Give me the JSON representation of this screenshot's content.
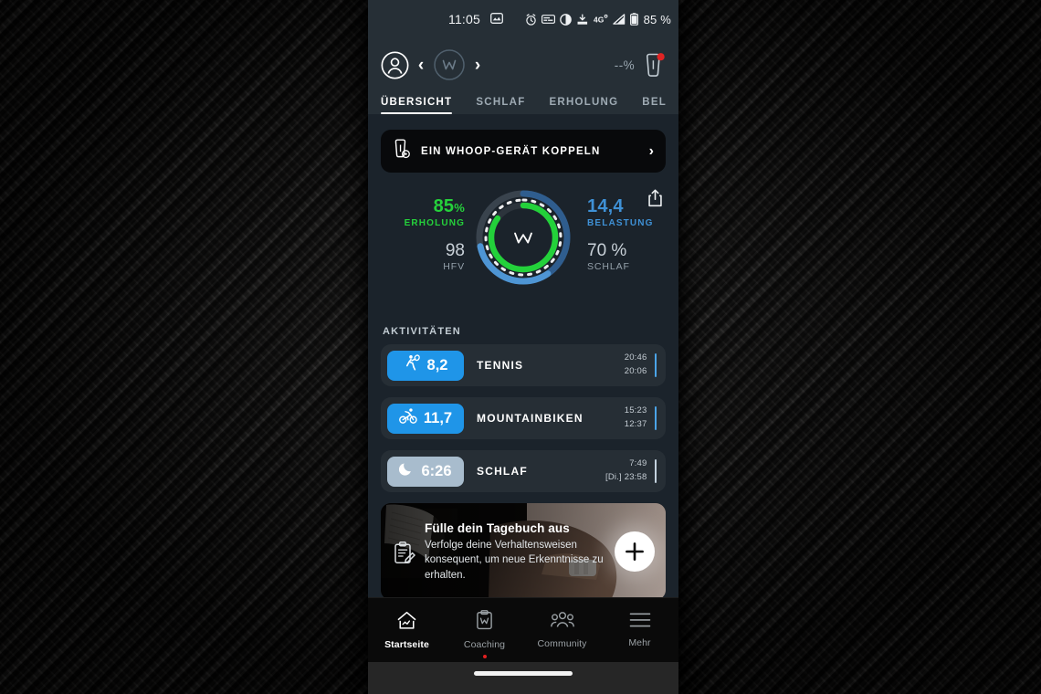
{
  "status_bar": {
    "time": "11:05",
    "battery_percent": "85 %",
    "icons": [
      "screenshot-icon",
      "alarm-icon",
      "subtitles-icon",
      "dnd-icon",
      "download-icon",
      "network-4g-icon",
      "signal-icon",
      "battery-icon"
    ]
  },
  "header": {
    "avatar": "profile-avatar-icon",
    "prev_label": "‹",
    "next_label": "›",
    "center_logo": "whoop-logo-icon",
    "battery_text": "--%",
    "strap_icon": "whoop-strap-icon",
    "tabs": [
      {
        "label": "ÜBERSICHT",
        "active": true
      },
      {
        "label": "SCHLAF",
        "active": false
      },
      {
        "label": "ERHOLUNG",
        "active": false
      },
      {
        "label": "BELASTUI",
        "active": false
      }
    ]
  },
  "pair_banner": {
    "label": "EIN WHOOP-GERÄT KOPPELN",
    "icon": "whoop-strap-icon",
    "chevron": "›"
  },
  "metrics": {
    "share_icon": "share-icon",
    "recovery": {
      "value": "85",
      "unit": "%",
      "label": "ERHOLUNG",
      "color": "#25d13b"
    },
    "hrv": {
      "value": "98",
      "label": "HFV"
    },
    "strain": {
      "value": "14,4",
      "label": "BELASTUNG",
      "color": "#3f91d6"
    },
    "sleep": {
      "value": "70 %",
      "label": "SCHLAF"
    },
    "ring": {
      "center_logo": "whoop-logo-icon",
      "recovery_percent": 85,
      "strain_percent": 72,
      "sleep_percent": 70
    }
  },
  "activities": {
    "section_title": "AKTIVITÄTEN",
    "items": [
      {
        "value": "8,2",
        "name": "TENNIS",
        "icon": "tennis-icon",
        "pill_color": "#1f95e8",
        "pill_text": "#ffffff",
        "bar_color": "#4ba4e8",
        "end_time": "20:46",
        "start_time": "20:06"
      },
      {
        "value": "11,7",
        "name": "MOUNTAINBIKEN",
        "icon": "mountain-bike-icon",
        "pill_color": "#1f95e8",
        "pill_text": "#ffffff",
        "bar_color": "#4ba4e8",
        "end_time": "15:23",
        "start_time": "12:37"
      },
      {
        "value": "6:26",
        "name": "SCHLAF",
        "icon": "moon-icon",
        "pill_color": "#a8bccd",
        "pill_text": "#ffffff",
        "bar_color": "#c3d2de",
        "end_time": "7:49",
        "start_time": "[Di.] 23:58"
      }
    ]
  },
  "journal": {
    "icon": "journal-clipboard-icon",
    "title": "Fülle dein Tagebuch aus",
    "description": "Verfolge deine Verhaltensweisen konsequent, um neue Erkenntnisse zu erhalten.",
    "add_button": "+"
  },
  "bottom_nav": {
    "items": [
      {
        "label": "Startseite",
        "icon": "home-icon",
        "active": true,
        "badge": false
      },
      {
        "label": "Coaching",
        "icon": "clipboard-w-icon",
        "active": false,
        "badge": true
      },
      {
        "label": "Community",
        "icon": "people-icon",
        "active": false,
        "badge": false
      },
      {
        "label": "Mehr",
        "icon": "menu-icon",
        "active": false,
        "badge": false
      }
    ]
  }
}
